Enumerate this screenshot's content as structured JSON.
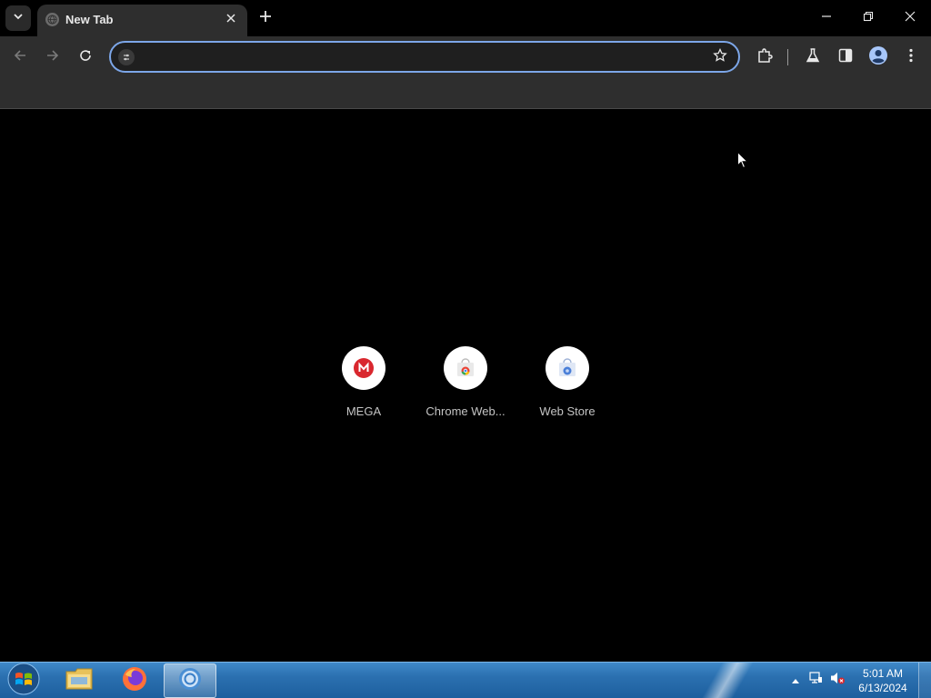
{
  "browser": {
    "tab": {
      "title": "New Tab"
    },
    "omnibox": {
      "value": "",
      "placeholder": ""
    }
  },
  "shortcuts": [
    {
      "label": "MEGA"
    },
    {
      "label": "Chrome Web..."
    },
    {
      "label": "Web Store"
    }
  ],
  "taskbar": {
    "clock": {
      "time": "5:01 AM",
      "date": "6/13/2024"
    }
  },
  "colors": {
    "omnibox_focus": "#7ca6e8",
    "mega_red": "#d9272e",
    "taskbar_blue": "#2b70b0"
  }
}
